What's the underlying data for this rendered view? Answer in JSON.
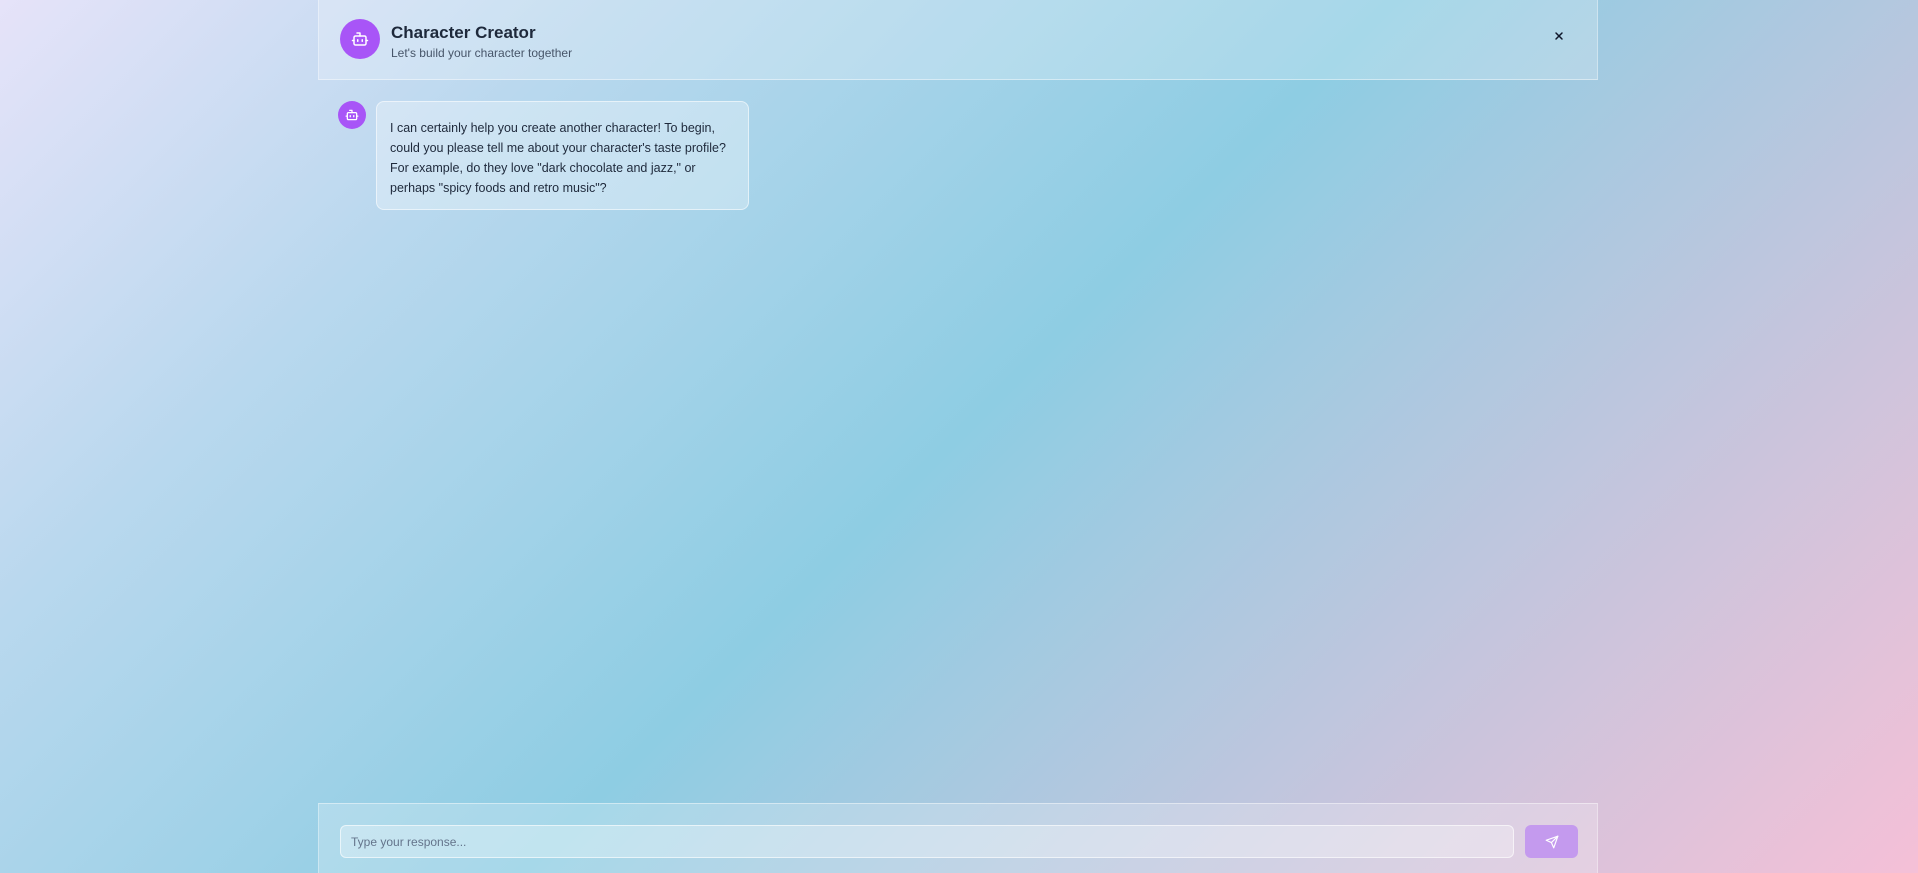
{
  "header": {
    "title": "Character Creator",
    "subtitle": "Let's build your character together",
    "avatar_icon": "bot-icon",
    "close_icon": "close-icon"
  },
  "messages": [
    {
      "sender": "assistant",
      "avatar_icon": "bot-icon",
      "text": "I can certainly help you create another character! To begin, could you please tell me about your character's taste profile? For example, do they love \"dark chocolate and jazz,\" or perhaps \"spicy foods and retro music\"?"
    }
  ],
  "composer": {
    "placeholder": "Type your response...",
    "value": "",
    "send_icon": "send-icon"
  },
  "colors": {
    "accent": "#a855f7",
    "send_button": "#c49aee"
  }
}
